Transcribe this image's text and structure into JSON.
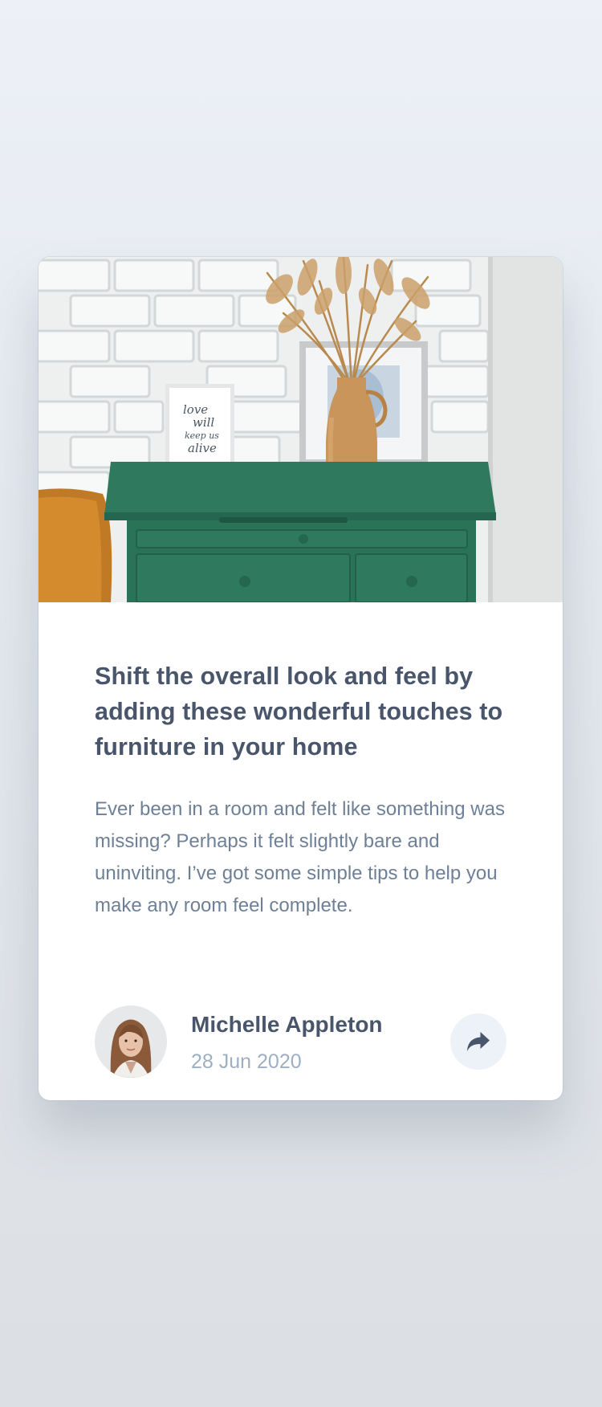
{
  "article": {
    "title": "Shift the overall look and feel by adding these wonderful touches to furniture in your home",
    "description": "Ever been in a room and felt like something was missing? Perhaps it felt slightly bare and uninviting. I’ve got some simple tips to help you make any room feel complete.",
    "image_frame_text": [
      "love",
      "will",
      "keep us",
      "alive"
    ]
  },
  "author": {
    "name": "Michelle Appleton",
    "date": "28 Jun 2020"
  },
  "icons": {
    "share": "share-icon"
  },
  "colors": {
    "heading": "#48556a",
    "body": "#6e8098",
    "date": "#9eafc2",
    "share_bg": "#ecf2f8",
    "drawer_green": "#2f7a5f"
  }
}
